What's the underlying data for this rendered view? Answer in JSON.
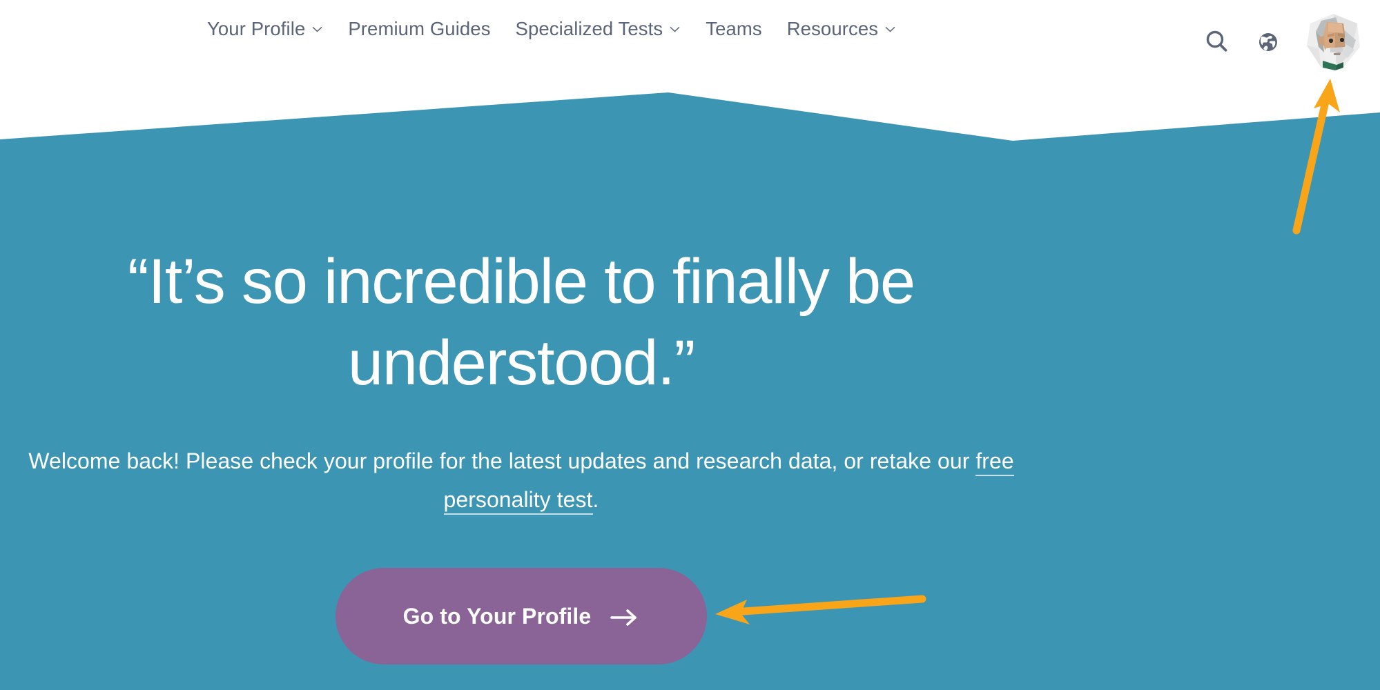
{
  "page": {
    "background_color": "#ffffff",
    "hero_color": "#3d95b4",
    "accent_color": "#8a6496",
    "nav_text_color": "#5c6478",
    "annotation_color": "#f9a51a"
  },
  "nav": {
    "items": [
      {
        "label": "Your Profile",
        "has_dropdown": true,
        "icon": "chevron-down-icon"
      },
      {
        "label": "Premium Guides",
        "has_dropdown": false,
        "icon": ""
      },
      {
        "label": "Specialized Tests",
        "has_dropdown": true,
        "icon": "chevron-down-icon"
      },
      {
        "label": "Teams",
        "has_dropdown": false,
        "icon": ""
      },
      {
        "label": "Resources",
        "has_dropdown": true,
        "icon": "chevron-down-icon"
      }
    ],
    "actions": [
      {
        "name": "search-icon",
        "label": "Search"
      },
      {
        "name": "globe-icon",
        "label": "Language"
      }
    ],
    "avatar": {
      "name": "user-avatar",
      "label": "Your account"
    }
  },
  "hero": {
    "title": "“It’s so incredible to finally be understood.”",
    "subtitle_before": "Welcome back! Please check your profile for the latest updates and research data, or retake our ",
    "subtitle_link": "free personality test",
    "subtitle_after": ".",
    "cta_label": "Go to Your Profile",
    "cta_icon": "arrow-right-icon"
  },
  "annotations": [
    {
      "name": "arrow-to-avatar",
      "direction": "up",
      "points_at": "user-avatar"
    },
    {
      "name": "arrow-to-cta",
      "direction": "left",
      "points_at": "cta-button"
    }
  ]
}
